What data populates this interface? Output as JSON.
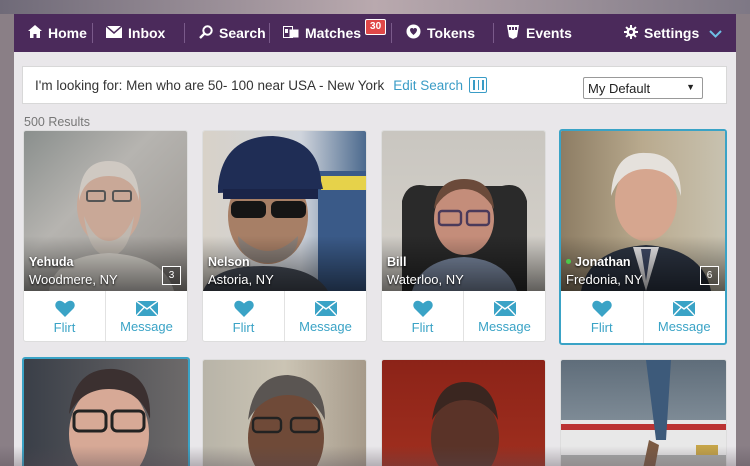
{
  "nav": {
    "items": [
      {
        "label": "Home",
        "icon": "home-icon"
      },
      {
        "label": "Inbox",
        "icon": "envelope-icon"
      },
      {
        "label": "Search",
        "icon": "search-icon"
      },
      {
        "label": "Matches",
        "icon": "matches-icon",
        "badge": "30"
      },
      {
        "label": "Tokens",
        "icon": "token-icon"
      },
      {
        "label": "Events",
        "icon": "events-icon"
      },
      {
        "label": "Settings",
        "icon": "gear-icon"
      }
    ]
  },
  "search": {
    "looking_for": "I'm looking for: Men who are 50- 100 near USA - New York",
    "edit_label": "Edit Search",
    "select_value": "My Default"
  },
  "results_count": "500 Results",
  "actions": {
    "flirt": "Flirt",
    "message": "Message"
  },
  "profiles": [
    {
      "name": "Yehuda",
      "location": "Woodmere, NY",
      "photo_count": "3"
    },
    {
      "name": "Nelson",
      "location": "Astoria, NY",
      "photo_count": ""
    },
    {
      "name": "Bill",
      "location": "Waterloo, NY",
      "photo_count": ""
    },
    {
      "name": "Jonathan",
      "location": "Fredonia, NY",
      "photo_count": "6"
    }
  ],
  "colors": {
    "nav_bg": "#4b2a5b",
    "accent": "#3aa3c6",
    "badge": "#e04848"
  }
}
